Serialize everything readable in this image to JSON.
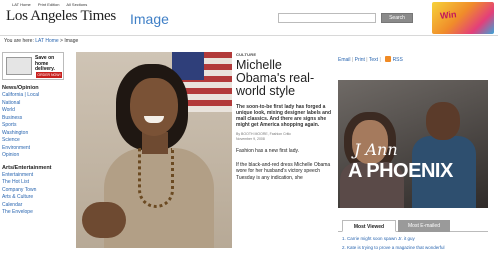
{
  "header": {
    "top_links": [
      "LAT Home",
      "Print Edition",
      "All Sections"
    ],
    "logo": "Los Angeles Times",
    "section_title": "Image",
    "search_button": "Search",
    "promo_text": "Win"
  },
  "breadcrumb": {
    "prefix": "You are here:",
    "home": "LAT Home",
    "current": "Image"
  },
  "sidebar": {
    "delivery": {
      "line1": "Save on",
      "line2": "home",
      "line3": "delivery.",
      "button": "ORDER NOW!"
    },
    "news_heading": "News/Opinion",
    "news_items": [
      "California | Local",
      "National",
      "World",
      "Business",
      "Sports",
      "Washington",
      "Science",
      "Environment",
      "Opinion"
    ],
    "arts_heading": "Arts/Entertainment",
    "arts_items": [
      "Entertainment",
      "The Hot List",
      "Company Town",
      "Arts & Culture",
      "Calendar",
      "The Envelope"
    ]
  },
  "article": {
    "kicker": "CULTURE",
    "headline": "Michelle Obama's real-world style",
    "dek": "The soon-to-be first lady has forged a unique look, mixing designer labels and mall classics. And there are signs she might get America shopping again.",
    "byline": "By BOOTH MOORE, Fashion Critic",
    "dateline": "November 9, 2008",
    "para1": "Fashion has a new first lady.",
    "para2": "If the black-and-red dress Michelle Obama wore for her husband's victory speech Tuesday is any indication, she"
  },
  "utility": {
    "email": "Email",
    "print": "Print",
    "text": "Text",
    "rss": "RSS"
  },
  "promo": {
    "script": "J Ann",
    "title": "A PHOENIX"
  },
  "most_viewed": {
    "tab_active": "Most Viewed",
    "tab_inactive": "Most E-mailed",
    "items": [
      "1. Carrie might soon spawn Jr. it guy",
      "2. Kate is trying to prove a magazine that wonderful"
    ]
  }
}
